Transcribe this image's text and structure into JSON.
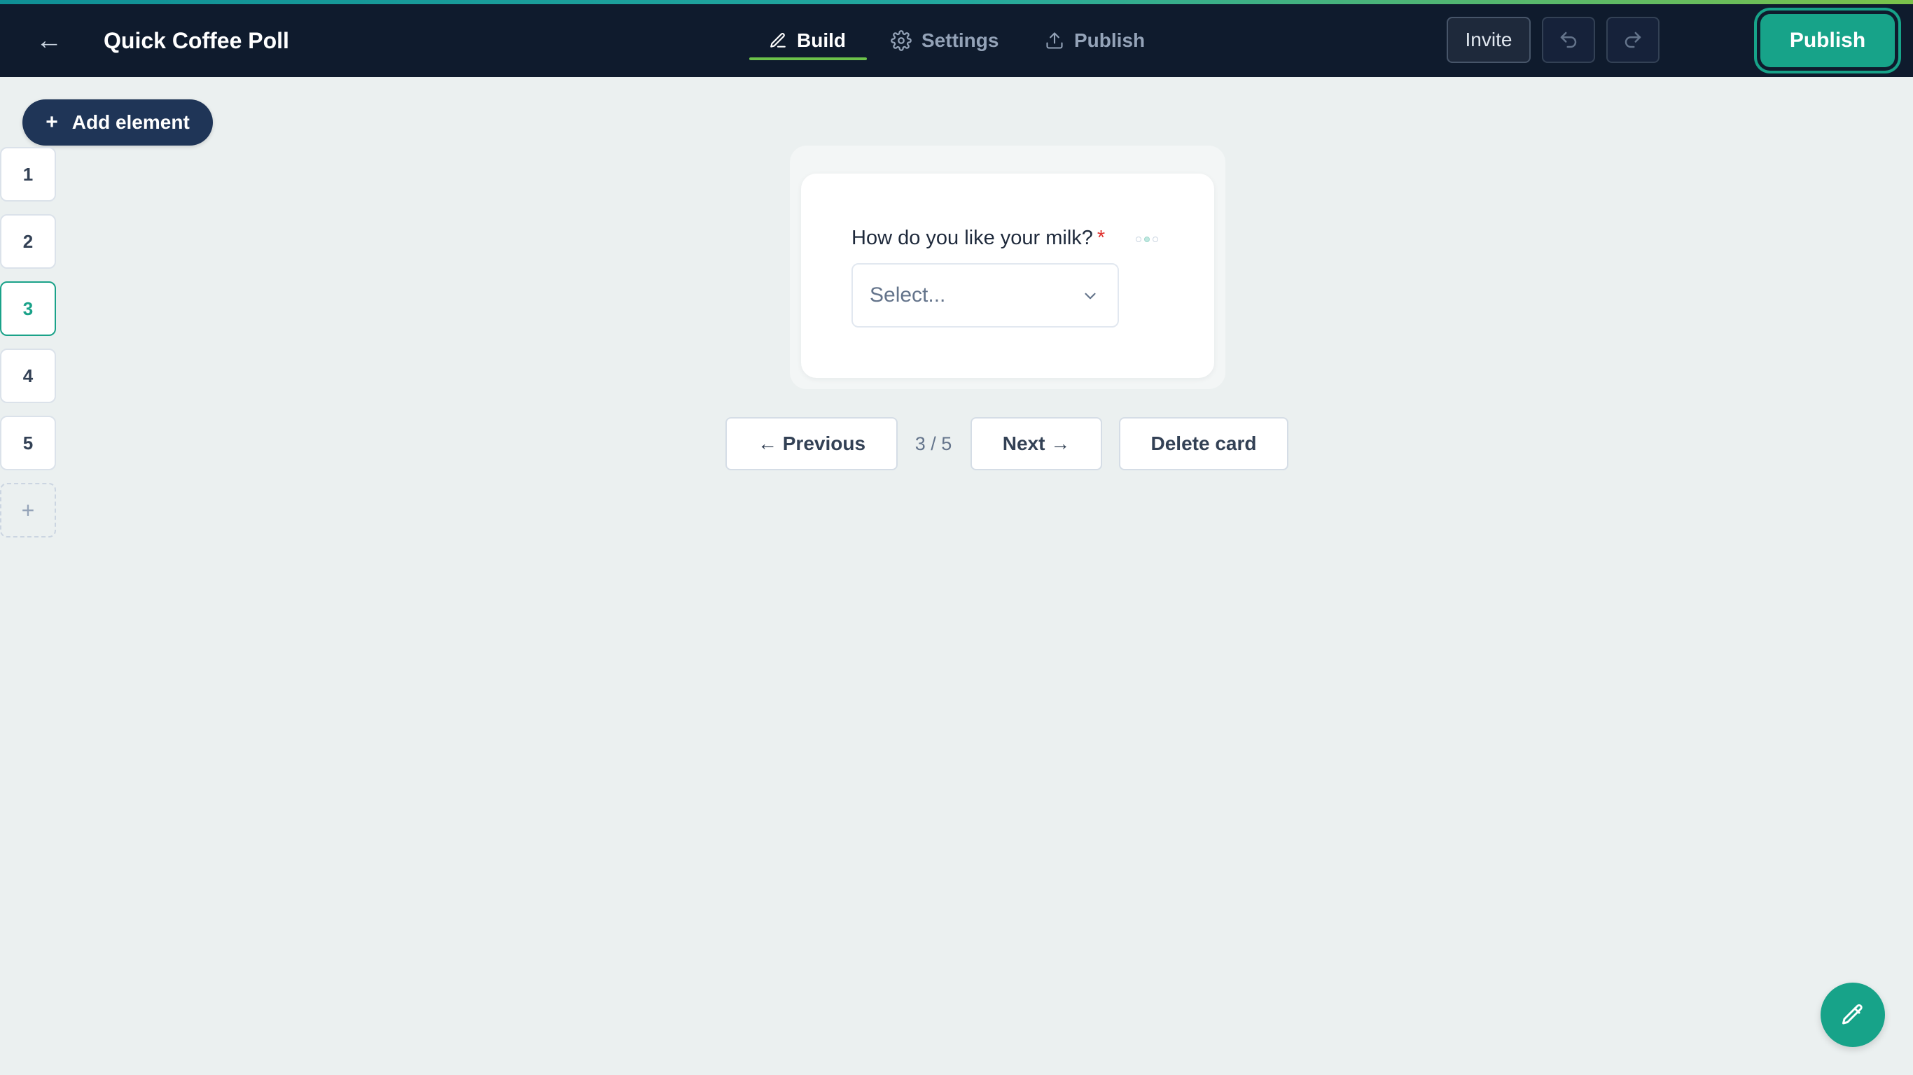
{
  "header": {
    "back_icon": "back-arrow-icon",
    "back_glyph": "←",
    "title": "Quick Coffee Poll",
    "tabs": [
      {
        "label": "Build",
        "icon": "pencil-icon",
        "active": true
      },
      {
        "label": "Settings",
        "icon": "gear-icon",
        "active": false
      },
      {
        "label": "Publish",
        "icon": "upload-icon",
        "active": false
      }
    ],
    "invite_label": "Invite",
    "undo_icon": "undo-icon",
    "redo_icon": "redo-icon",
    "publish_label": "Publish"
  },
  "sidebar": {
    "add_element_label": "Add element",
    "add_element_plus": "+",
    "cards": [
      "1",
      "2",
      "3",
      "4",
      "5"
    ],
    "active_card": "3",
    "add_card_label": "+"
  },
  "card": {
    "question": "How do you like your milk?",
    "required_mark": "*",
    "select_placeholder": "Select..."
  },
  "navigation": {
    "previous_label": "← Previous",
    "page_indicator": "3 / 5",
    "next_label": "Next →",
    "delete_label": "Delete card"
  },
  "fab": {
    "icon": "pencil-icon"
  },
  "colors": {
    "topbar": "#0f1b2d",
    "accent": "#17a389",
    "tab_underline": "#6cc24a",
    "canvas": "#ebf0f0",
    "add_element": "#1f3557",
    "required": "#e0322f"
  }
}
